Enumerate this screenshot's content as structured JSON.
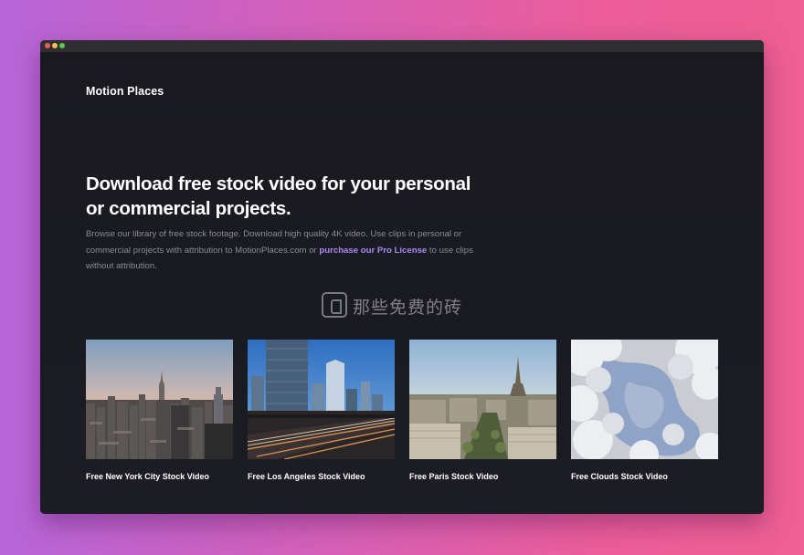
{
  "window": {
    "controls": [
      "close",
      "minimize",
      "zoom"
    ]
  },
  "brand": "Motion Places",
  "hero": {
    "title": "Download free stock video for your personal or commercial projects.",
    "description_before": "Browse our library of free stock footage. Download high quality 4K video. Use clips in personal or commercial projects with attribution to MotionPlaces.com or ",
    "link_label": "purchase our Pro License",
    "description_after": " to use clips without attribution."
  },
  "cards": [
    {
      "label": "Free New York City Stock Video",
      "image": "new-york-skyline"
    },
    {
      "label": "Free Los Angeles Stock Video",
      "image": "los-angeles-freeway"
    },
    {
      "label": "Free Paris Stock Video",
      "image": "paris-eiffel-tower"
    },
    {
      "label": "Free Clouds Stock Video",
      "image": "clouds-sky"
    }
  ],
  "watermark": {
    "text": "那些免费的砖"
  },
  "colors": {
    "accent_link": "#a98bf7",
    "background": "#17171d"
  }
}
